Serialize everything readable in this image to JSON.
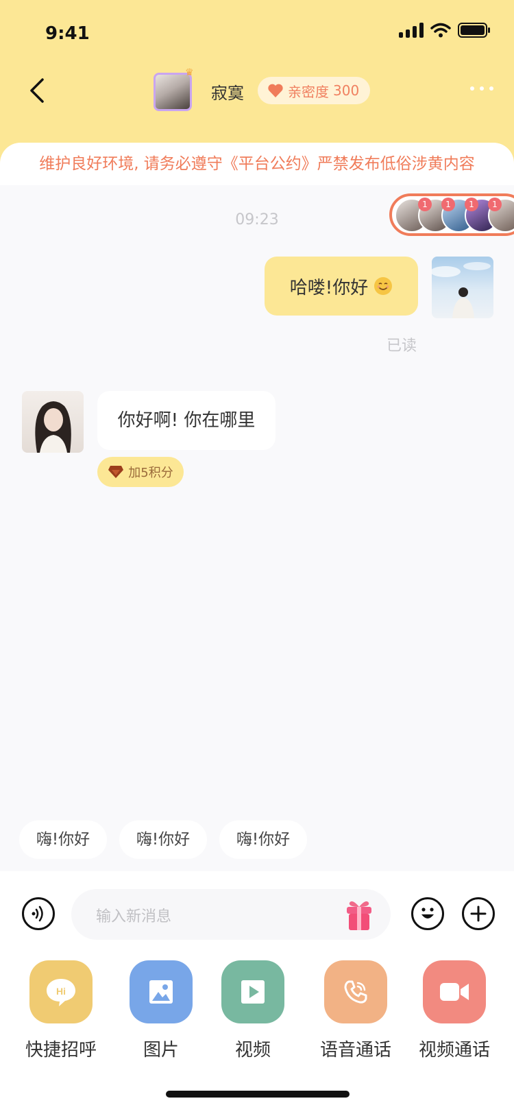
{
  "status_bar": {
    "time": "9:41"
  },
  "nav": {
    "back_icon": "chevron-left-icon",
    "name": "寂寞",
    "intimacy_label": "亲密度",
    "intimacy_value": "300",
    "more_icon": "more-dots-icon"
  },
  "notice": "维护良好环境, 请务必遵守《平台公约》严禁发布低俗涉黄内容",
  "avatar_stack": {
    "badges": [
      "1",
      "1",
      "1",
      "1"
    ]
  },
  "chat": {
    "timestamp": "09:23",
    "outgoing": {
      "text": "哈喽!你好",
      "emoji": "smile-emoji-icon",
      "status": "已读"
    },
    "incoming": {
      "text": "你好啊! 你在哪里",
      "reward": "加5积分"
    }
  },
  "quick_replies": [
    "嗨!你好",
    "嗨!你好",
    "嗨!你好"
  ],
  "input": {
    "placeholder": "输入新消息"
  },
  "actions": [
    {
      "label": "快捷招呼",
      "icon": "hi-chat-icon",
      "color": "#F0CB72"
    },
    {
      "label": "图片",
      "icon": "image-icon",
      "color": "#78A6E8"
    },
    {
      "label": "视频",
      "icon": "video-play-icon",
      "color": "#78B8A0"
    },
    {
      "label": "语音通话",
      "icon": "phone-call-icon",
      "color": "#F2B285"
    },
    {
      "label": "视频通话",
      "icon": "video-camera-icon",
      "color": "#F28A80"
    }
  ],
  "colors": {
    "header": "#FCE795",
    "accent": "#F07C5A",
    "background": "#F9F9FB"
  }
}
